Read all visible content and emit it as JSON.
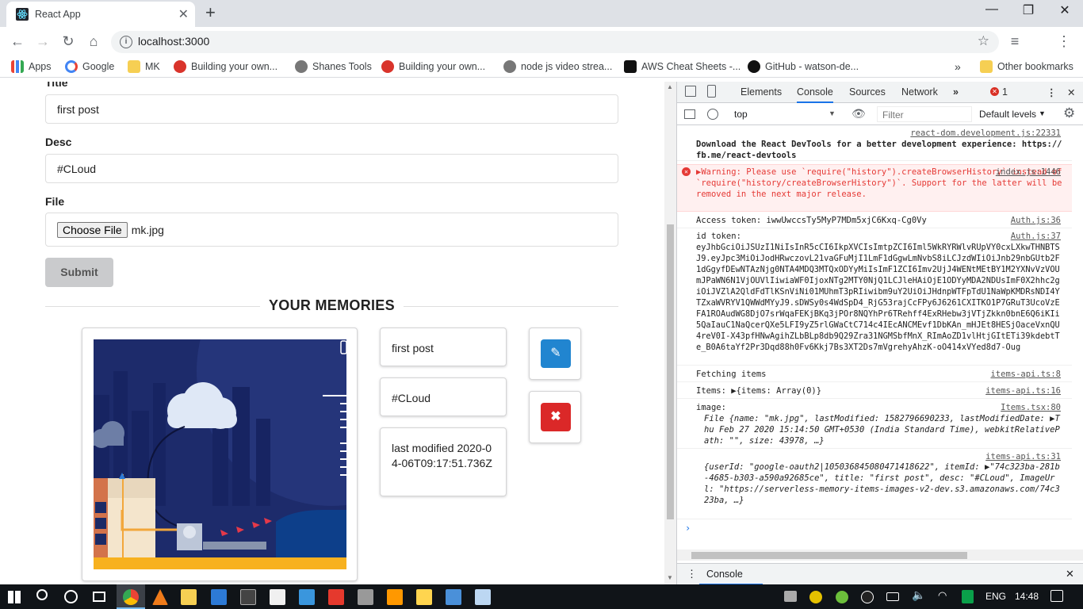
{
  "browser": {
    "tab_title": "React App",
    "url": "localhost:3000",
    "bookmarks": [
      "Apps",
      "Google",
      "MK",
      "Building your own...",
      "Shanes Tools",
      "Building your own...",
      "node js video strea...",
      "AWS Cheat Sheets -...",
      "GitHub - watson-de..."
    ],
    "other_bookmarks": "Other bookmarks"
  },
  "form": {
    "title_label": "Title",
    "title_value": "first post",
    "desc_label": "Desc",
    "desc_value": "#CLoud",
    "file_label": "File",
    "choose_file": "Choose File",
    "file_name": "mk.jpg",
    "submit": "Submit"
  },
  "memories": {
    "heading": "YOUR MEMORIES",
    "item": {
      "title": "first post",
      "desc": "#CLoud",
      "modified": "last modified 2020-04-06T09:17:51.736Z"
    }
  },
  "devtools": {
    "tabs": [
      "Elements",
      "Console",
      "Sources",
      "Network"
    ],
    "active_tab": "Console",
    "error_count": "1",
    "context": "top",
    "filter_placeholder": "Filter",
    "levels": "Default levels",
    "logs": [
      {
        "src": "react-dom.development.js:22331",
        "text": "Download the React DevTools for a better development experience: https://fb.me/react-devtools"
      },
      {
        "src": "index.js:1446",
        "text": "▶Warning: Please use `require(\"history\").createBrowserHistory` instead of `require(\"history/createBrowserHistory\")`. Support for the latter will be removed in the next major release."
      },
      {
        "src": "Auth.js:36",
        "text": "Access token:  iwwUwccsTy5MyP7MDm5xjC6Kxq-Cg0Vy"
      },
      {
        "src": "Auth.js:37",
        "text": "id token:"
      },
      {
        "text": "eyJhbGciOiJSUzI1NiIsInR5cCI6IkpXVCIsImtpZCI6Iml5WkRYRWlvRUpVY0cxLXkwTHNBTSJ9.eyJpc3MiOiJodHRwczovL21vaGFuMjI1LmF1dGgwLmNvbS8iLCJzdWIiOiJnb29nbGUtb2F1dGgyfDEwNTAzNjg0NTA4MDQ3MTQxODYyMiIsImF1ZCI6Imv2UjJ4WENtMEtBY1M2YXNvVzVOUmJPaWN6N1VjOUVlIiwiaWF0IjoxNTg2MTY0NjQ1LCJleHAiOjE1ODYyMDA2NDUsImF0X2hhc2giOiJVZlA2QldFdTlKSnViNi01MUhmT3pRIiwibm9uY2UiOiJHdnpWTFpTdU1NaWpKMDRsNDI4YTZxaWVRYV1QWWdMYyJ9.sDWSy0s4WdSpD4_RjG53rajCcFPy6J6261CXITKO1P7GRuT3UcoVzEFA1ROAudWG8DjO7srWqaFEKjBKq3jPOr8NQYhPr6TRehff4ExRHebw3jVTjZkkn0bnE6Q6iKIi5QaIauC1NaQcerQXe5LFI9yZ5rlGWaCtC714c4IEcANCMEvf1DbKAn_mHJEt8HESjOaceVxnQU4reV0I-X43pfHNwAgihZLbBLp8db9Q29Zra31NGMSbfMnX_RImAoZD1vlHtjGItETi39kdebtTe_B0A6taYf2Pr3Dqd88h0Fv6Kkj7Bs3XT2Ds7mVgrehyAhzK-oO414xVYed8d7-Oug"
      },
      {
        "src": "items-api.ts:8",
        "text": "Fetching items"
      },
      {
        "src": "items-api.ts:16",
        "text": "Items: ▶{items: Array(0)}"
      },
      {
        "src": "Items.tsx:80",
        "text": "image:"
      },
      {
        "text": "File {name: \"mk.jpg\", lastModified: 1582796690233, lastModifiedDate: ▶Thu Feb 27 2020 15:14:50 GMT+0530 (India Standard Time), webkitRelativePath: \"\", size: 43978, …}"
      },
      {
        "src": "items-api.ts:31",
        "text": "{userId: \"google-oauth2|105036845080471418622\", itemId: ▶\"74c323ba-281b-4685-b303-a590a92685ce\", title: \"first post\", desc: \"#CLoud\", ImageUrl: \"https://serverless-memory-items-images-v2-dev.s3.amazonaws.com/74c323ba, …}"
      }
    ],
    "drawer_tab": "Console"
  },
  "taskbar": {
    "lang": "ENG",
    "time": "14:48"
  }
}
